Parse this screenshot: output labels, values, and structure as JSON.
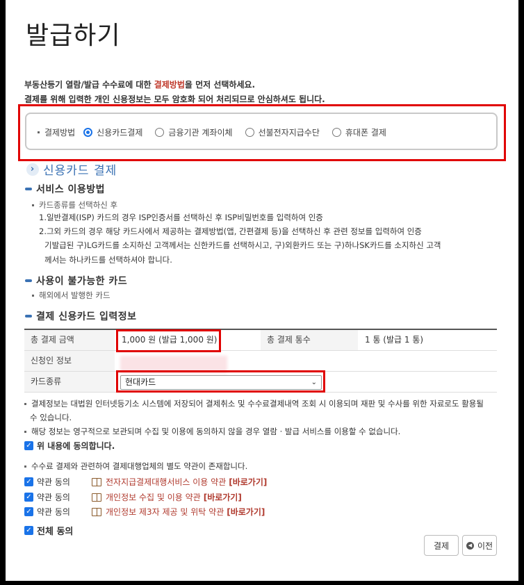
{
  "page": {
    "title": "발급하기",
    "intro1_prefix": "부동산등기 열람/발급 수수료에 대한 ",
    "intro1_highlight": "결제방법",
    "intro1_suffix": "을 먼저 선택하세요.",
    "intro2": "결제를 위해 입력한 개인 신용정보는 모두 암호화 되어 처리되므로 안심하셔도 됩니다."
  },
  "payment_method": {
    "label": "결제방법",
    "options": [
      {
        "label": "신용카드결제",
        "selected": true
      },
      {
        "label": "금융기관 계좌이체",
        "selected": false
      },
      {
        "label": "선불전자지급수단",
        "selected": false
      },
      {
        "label": "휴대폰 결제",
        "selected": false
      }
    ]
  },
  "section_title": "신용카드 결제",
  "usage": {
    "heading": "서비스 이용방법",
    "bullet": "카드종류를 선택하신 후",
    "line1": "1.일반결제(ISP) 카드의 경우 ISP인증서를 선택하신 후 ISP비밀번호를 입력하여 인증",
    "line2": "2.그외 카드의 경우 해당 카드사에서 제공하는 결제방법(앱, 간편결제 등)을 선택하신 후 관련 정보를 입력하여 인증",
    "line3": "기발급된 구)LG카드를 소지하신 고객께서는 신한카드를 선택하시고, 구)외환카드 또는 구)하나SK카드를 소지하신 고객",
    "line4": "께서는 하나카드를 선택하셔야 합니다."
  },
  "unusable": {
    "heading": "사용이 불가능한 카드",
    "bullet": "해외에서 발행한 카드"
  },
  "input_info": {
    "heading": "결제 신용카드 입력정보",
    "total_amount_label": "총 결제 금액",
    "total_amount_value": "1,000 원 (발급 1,000 원)",
    "total_count_label": "총 결제 통수",
    "total_count_value": "1 통 (발급 1 통)",
    "applicant_label": "신청인 정보",
    "card_type_label": "카드종류",
    "card_type_selected": "현대카드"
  },
  "notices": {
    "n1a": "결제정보는 대법원 인터넷등기소 시스템에 저장되어 결제취소 및 수수료결제내역 조회 시 이용되며 재판 및 수사를 위한 자료로도 활용될",
    "n1b": "수 있습니다.",
    "n2": "해당 정보는 영구적으로 보관되며 수집 및 이용에 동의하지 않을 경우 열람 · 발급 서비스를 이용할 수 없습니다.",
    "agree_label": "위 내용에 동의합니다.",
    "n3": "수수료 결제와 관련하여 결제대행업체의 별도 약관이 존재합니다."
  },
  "terms": [
    {
      "check_label": "약관 동의",
      "text": "전자지급결제대행서비스 이용 약관",
      "link": "[바로가기]"
    },
    {
      "check_label": "약관 동의",
      "text": "개인정보 수집 및 이용 약관",
      "link": "[바로가기]"
    },
    {
      "check_label": "약관 동의",
      "text": "개인정보 제3자 제공 및 위탁 약관",
      "link": "[바로가기]"
    }
  ],
  "all_agree_label": "전체 동의",
  "buttons": {
    "pay": "결제",
    "prev": "이전"
  },
  "colors": {
    "accent_blue": "#3b72b4",
    "highlight_red": "#e00000",
    "checkbox_blue": "#1a73e8"
  }
}
